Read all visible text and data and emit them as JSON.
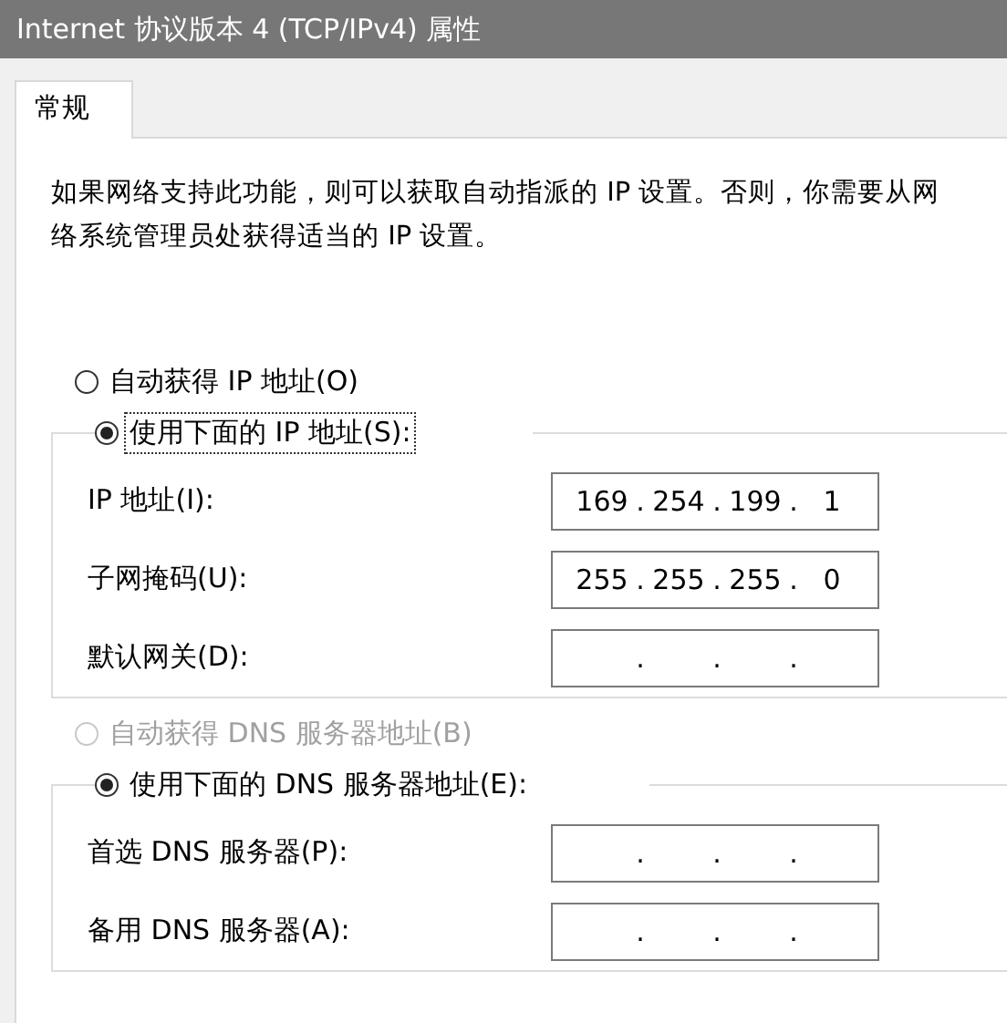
{
  "window": {
    "title": "Internet 协议版本 4 (TCP/IPv4) 属性"
  },
  "tabs": [
    {
      "label": "常规",
      "selected": true
    }
  ],
  "description": "如果网络支持此功能，则可以获取自动指派的 IP 设置。否则，你需要从网络系统管理员处获得适当的 IP 设置。",
  "sections": [
    {
      "auto": {
        "label": "自动获得 IP 地址(O)",
        "selected": false,
        "disabled": false
      },
      "manual": {
        "label": "使用下面的 IP 地址(S):",
        "selected": true,
        "disabled": false,
        "focused": true
      },
      "fields": [
        {
          "label": "IP 地址(I):",
          "dot": ".",
          "octets": [
            "169",
            "254",
            "199",
            "1"
          ]
        },
        {
          "label": "子网掩码(U):",
          "dot": ".",
          "octets": [
            "255",
            "255",
            "255",
            "0"
          ]
        },
        {
          "label": "默认网关(D):",
          "dot": "."
        }
      ]
    },
    {
      "auto": {
        "label": "自动获得 DNS 服务器地址(B)",
        "selected": false,
        "disabled": true
      },
      "manual": {
        "label": "使用下面的 DNS 服务器地址(E):",
        "selected": true,
        "disabled": false,
        "focused": false
      },
      "fields": [
        {
          "label": "首选 DNS 服务器(P):",
          "dot": "."
        },
        {
          "label": "备用 DNS 服务器(A):",
          "dot": "."
        }
      ]
    }
  ]
}
